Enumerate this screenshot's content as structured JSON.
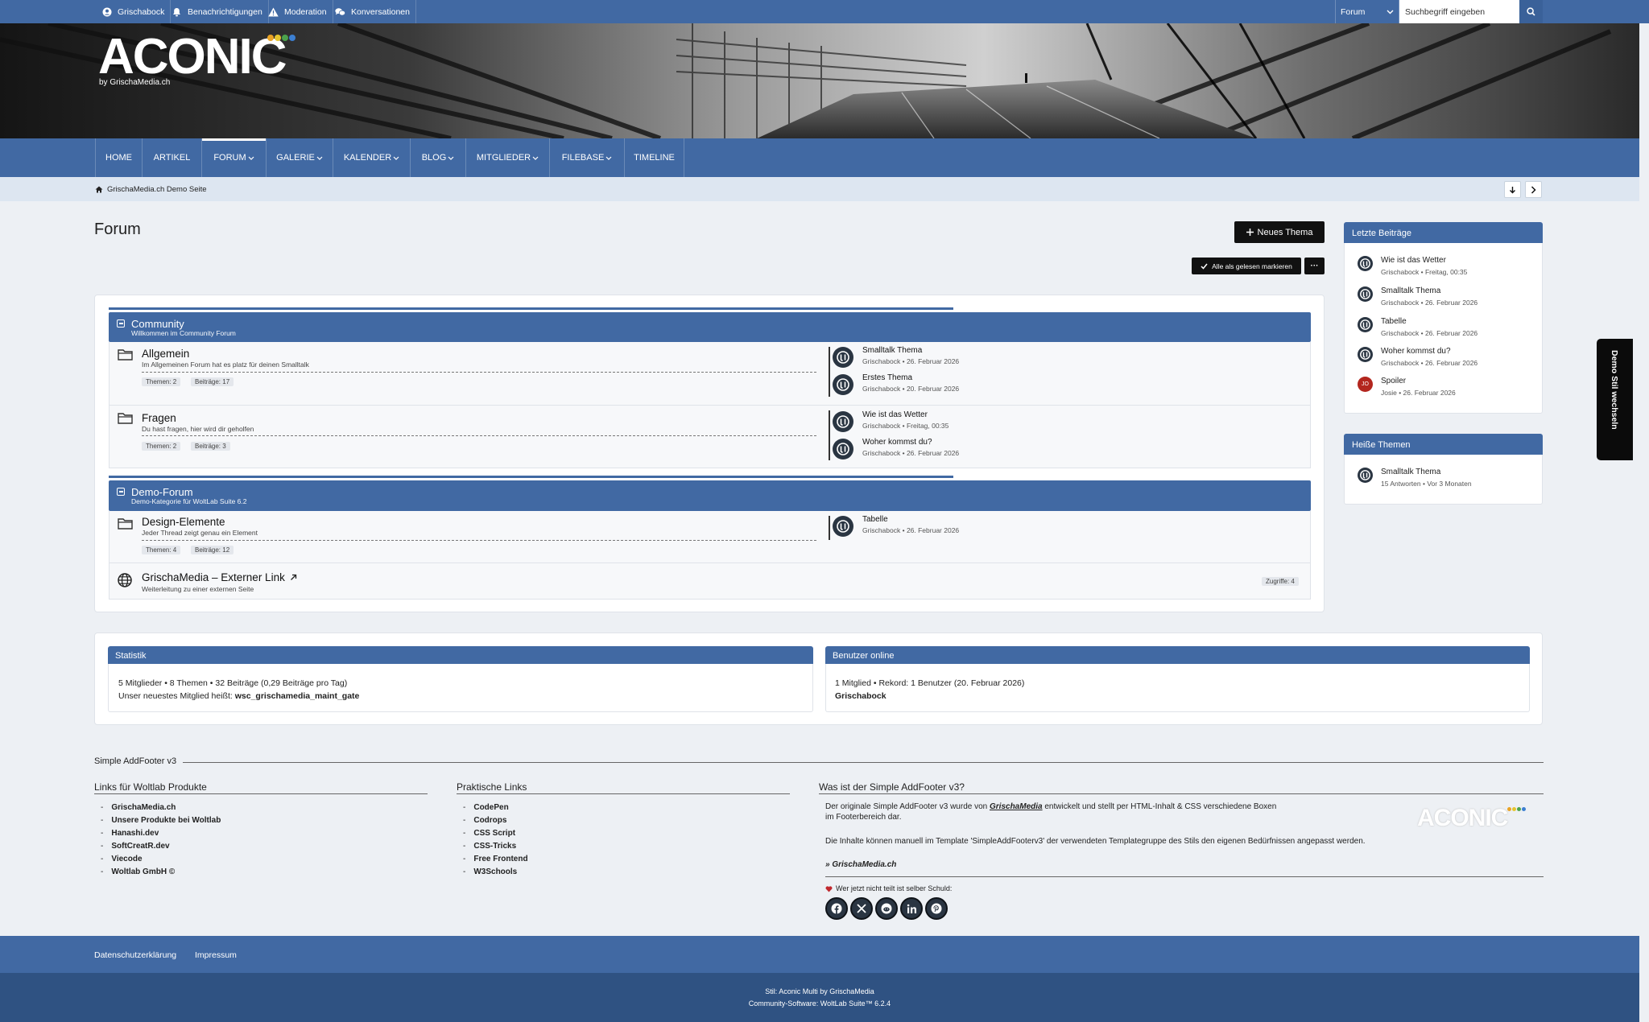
{
  "topbar": {
    "user": "Grischabock",
    "notifications": "Benachrichtigungen",
    "moderation": "Moderation",
    "conversations": "Konversationen",
    "search_scope": "Forum",
    "search_placeholder": "Suchbegriff eingeben"
  },
  "logo": {
    "text": "ACONIC",
    "sub": "by GrischaMedia.ch",
    "dot_colors": [
      "#e9a325",
      "#e5c52d",
      "#4ca24c",
      "#3c7fd1"
    ]
  },
  "nav": [
    {
      "label": "HOME",
      "dropdown": false,
      "active": false
    },
    {
      "label": "ARTIKEL",
      "dropdown": false,
      "active": false
    },
    {
      "label": "FORUM",
      "dropdown": true,
      "active": true
    },
    {
      "label": "GALERIE",
      "dropdown": true,
      "active": false
    },
    {
      "label": "KALENDER",
      "dropdown": true,
      "active": false
    },
    {
      "label": "BLOG",
      "dropdown": true,
      "active": false
    },
    {
      "label": "MITGLIEDER",
      "dropdown": true,
      "active": false
    },
    {
      "label": "FILEBASE",
      "dropdown": true,
      "active": false
    },
    {
      "label": "TIMELINE",
      "dropdown": false,
      "active": false
    }
  ],
  "breadcrumb": {
    "label": "GrischaMedia.ch Demo Seite"
  },
  "page": {
    "title": "Forum",
    "new_topic": "Neues Thema",
    "mark_read": "Alle als gelesen markieren",
    "more": "···"
  },
  "categories": [
    {
      "title": "Community",
      "description": "Willkommen im Community Forum",
      "boards": [
        {
          "title": "Allgemein",
          "description": "Im Allgemeinen Forum hat es platz für deinen Smalltalk",
          "topics": "Themen: 2",
          "posts": "Beiträge: 17",
          "last_posts": [
            {
              "title": "Smalltalk Thema",
              "meta": "Grischabock • 26. Februar 2026"
            },
            {
              "title": "Erstes Thema",
              "meta": "Grischabock • 20. Februar 2026"
            }
          ]
        },
        {
          "title": "Fragen",
          "description": "Du hast fragen, hier wird dir geholfen",
          "topics": "Themen: 2",
          "posts": "Beiträge: 3",
          "last_posts": [
            {
              "title": "Wie ist das Wetter",
              "meta": "Grischabock • Freitag, 00:35"
            },
            {
              "title": "Woher kommst du?",
              "meta": "Grischabock • 26. Februar 2026"
            }
          ]
        }
      ]
    },
    {
      "title": "Demo-Forum",
      "description": "Demo-Kategorie für WoltLab Suite 6.2",
      "boards": [
        {
          "title": "Design-Elemente",
          "description": "Jeder Thread zeigt genau ein Element",
          "topics": "Themen: 4",
          "posts": "Beiträge: 12",
          "last_posts": [
            {
              "title": "Tabelle",
              "meta": "Grischabock • 26. Februar 2026"
            }
          ]
        }
      ],
      "external": {
        "title": "GrischaMedia – Externer Link",
        "description": "Weiterleitung zu einer externen Seite",
        "hits": "Zugriffe: 4"
      }
    }
  ],
  "sidebar": {
    "latest_title": "Letzte Beiträge",
    "latest": [
      {
        "title": "Wie ist das Wetter",
        "meta": "Grischabock • Freitag, 00:35"
      },
      {
        "title": "Smalltalk Thema",
        "meta": "Grischabock • 26. Februar 2026"
      },
      {
        "title": "Tabelle",
        "meta": "Grischabock • 26. Februar 2026"
      },
      {
        "title": "Woher kommst du?",
        "meta": "Grischabock • 26. Februar 2026"
      },
      {
        "title": "Spoiler",
        "meta": "Josie • 26. Februar 2026",
        "initials": "JO"
      }
    ],
    "hot_title": "Heiße Themen",
    "hot": [
      {
        "title": "Smalltalk Thema",
        "meta": "15 Antworten • Vor 3 Monaten"
      }
    ]
  },
  "demo_tab": "Demo Stil wechseln",
  "stats": {
    "title": "Statistik",
    "line1": "5 Mitglieder • 8 Themen • 32 Beiträge (0,29 Beiträge pro Tag)",
    "line2_prefix": "Unser neuestes Mitglied heißt: ",
    "newest_member": "wsc_grischamedia_maint_gate"
  },
  "online": {
    "title": "Benutzer online",
    "line1": "1 Mitglied • Rekord: 1 Benutzer (20. Februar 2026)",
    "user": "Grischabock"
  },
  "addfooter": {
    "title": "Simple AddFooter v3",
    "col1_title": "Links für Woltlab Produkte",
    "col1_links": [
      "GrischaMedia.ch",
      "Unsere Produkte bei Woltlab",
      "Hanashi.dev",
      "SoftCreatR.dev",
      "Viecode",
      "Woltlab GmbH ©"
    ],
    "col2_title": "Praktische Links",
    "col2_links": [
      "CodePen",
      "Codrops",
      "CSS Script",
      "CSS-Tricks",
      "Free Frontend",
      "W3Schools"
    ],
    "col3_title": "Was ist der Simple AddFooter v3?",
    "col3_p1_a": "Der originale Simple AddFooter v3 wurde von ",
    "col3_p1_author": "GrischaMedia",
    "col3_p1_b": " entwickelt und stellt per HTML-Inhalt & CSS verschiedene Boxen im Footerbereich dar.",
    "col3_p2": "Die Inhalte können manuell im Template 'SimpleAddFooterv3' der verwendeten Templategruppe des Stils den eigenen Bedürfnissen angepasst werden.",
    "col3_link": "» GrischaMedia.ch",
    "share_text": "Wer jetzt nicht teilt ist selber Schuld:",
    "logo_text": "ACONIC"
  },
  "footer": {
    "privacy": "Datenschutzerklärung",
    "imprint": "Impressum",
    "style_line": "Stil: Aconic Multi by GrischaMedia",
    "software_line": "Community-Software: WoltLab Suite™ 6.2.4"
  },
  "colors": {
    "accent": "#4169a3",
    "footer_dark": "#2f5282",
    "background": "#edf0f4"
  }
}
